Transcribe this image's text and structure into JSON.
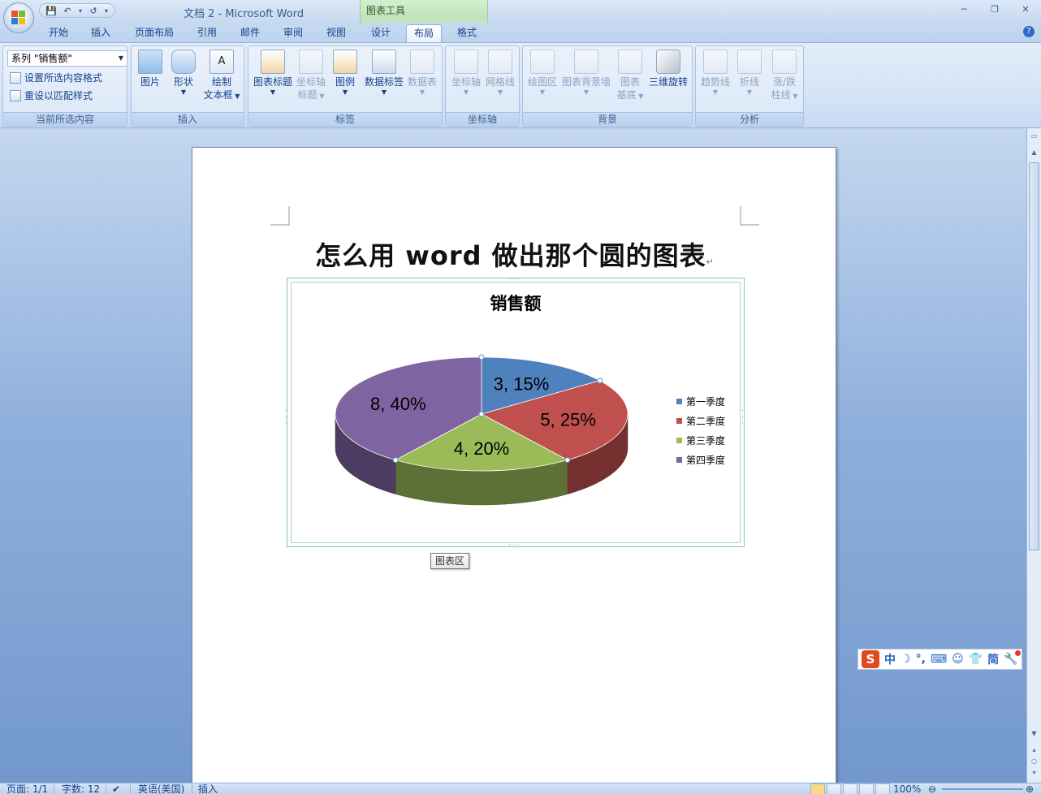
{
  "window": {
    "title": "文档 2 - Microsoft Word",
    "context_tab": "图表工具",
    "controls": [
      "─",
      "❐",
      "✕"
    ]
  },
  "qat": {
    "save": "💾",
    "undo": "↶",
    "undo_dd": "▾",
    "redo": "↺",
    "customize": "▾"
  },
  "tabs": [
    {
      "label": "开始"
    },
    {
      "label": "插入"
    },
    {
      "label": "页面布局"
    },
    {
      "label": "引用"
    },
    {
      "label": "邮件"
    },
    {
      "label": "审阅"
    },
    {
      "label": "视图"
    },
    {
      "label": "设计"
    },
    {
      "label": "布局"
    },
    {
      "label": "格式"
    }
  ],
  "help": "?",
  "ribbon": {
    "current_selection": {
      "dropdown_value": "系列 \"销售额\"",
      "format_selection": "设置所选内容格式",
      "reset_style": "重设以匹配样式",
      "label": "当前所选内容"
    },
    "insert": {
      "picture": "图片",
      "shapes": "形状",
      "textbox_line1": "绘制",
      "textbox_line2": "文本框",
      "label": "插入"
    },
    "labels": {
      "chart_title": "图表标题",
      "axis_titles_line1": "坐标轴",
      "axis_titles_line2": "标题",
      "legend": "图例",
      "data_labels": "数据标签",
      "data_table": "数据表",
      "label": "标签"
    },
    "axes": {
      "axes": "坐标轴",
      "gridlines": "网格线",
      "label": "坐标轴"
    },
    "background": {
      "plot_area": "绘图区",
      "chart_wall": "图表背景墙",
      "floor_line1": "图表",
      "floor_line2": "基底",
      "rotation": "三维旋转",
      "label": "背景"
    },
    "analysis": {
      "trendline": "趋势线",
      "lines": "折线",
      "updown_line1": "涨/跌",
      "updown_line2": "柱线",
      "label": "分析"
    }
  },
  "document": {
    "heading": "怎么用 word 做出那个圆的图表",
    "para_mark": "↵"
  },
  "chart_data": {
    "type": "pie",
    "title": "销售额",
    "categories": [
      "第一季度",
      "第二季度",
      "第三季度",
      "第四季度"
    ],
    "values": [
      3,
      5,
      4,
      8
    ],
    "data_labels": [
      "3, 15%",
      "5, 25%",
      "4, 20%",
      "8, 40%"
    ],
    "colors": [
      "#4f81bd",
      "#c0504d",
      "#9bbb59",
      "#8064a2"
    ],
    "legend": "right",
    "style": "3d"
  },
  "tooltip": "图表区",
  "statusbar": {
    "page": "页面: 1/1",
    "words": "字数: 12",
    "language": "英语(美国)",
    "mode": "插入",
    "zoom": "100%",
    "zoom_out": "⊖",
    "zoom_in": "⊕"
  },
  "ime": {
    "logo": "S",
    "mode": "中",
    "simplified": "简"
  }
}
